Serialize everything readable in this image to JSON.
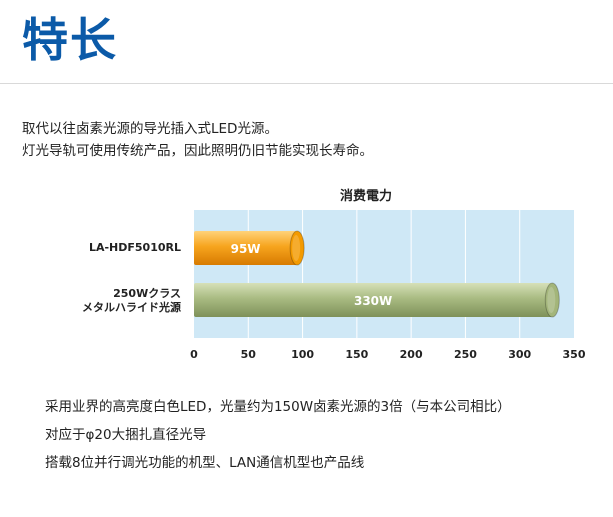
{
  "page": {
    "title": "特长",
    "intro": [
      "取代以往卤素光源的导光插入式LED光源。",
      "灯光导轨可使用传统产品，因此照明仍旧节能实现长寿命。"
    ],
    "features": [
      "采用业界的高亮度白色LED，光量约为150W卤素光源的3倍（与本公司相比）",
      "对应于φ20大捆扎直径光导",
      "搭载8位并行调光功能的机型、LAN通信机型也产品线"
    ]
  },
  "chart_data": {
    "type": "bar",
    "orientation": "horizontal",
    "title": "消费電力",
    "categories": [
      [
        "LA-HDF5010RL"
      ],
      [
        "250Wクラス",
        "メタルハライド光源"
      ]
    ],
    "series": [
      {
        "values": [
          95,
          330
        ],
        "data_labels": [
          "95W",
          "330W"
        ],
        "colors": [
          "#f39a00",
          "#a3b57a"
        ]
      }
    ],
    "xlim": [
      0,
      350
    ],
    "xticks": [
      0,
      50,
      100,
      150,
      200,
      250,
      300,
      350
    ],
    "grid": true,
    "background": "#cfe8f6"
  }
}
